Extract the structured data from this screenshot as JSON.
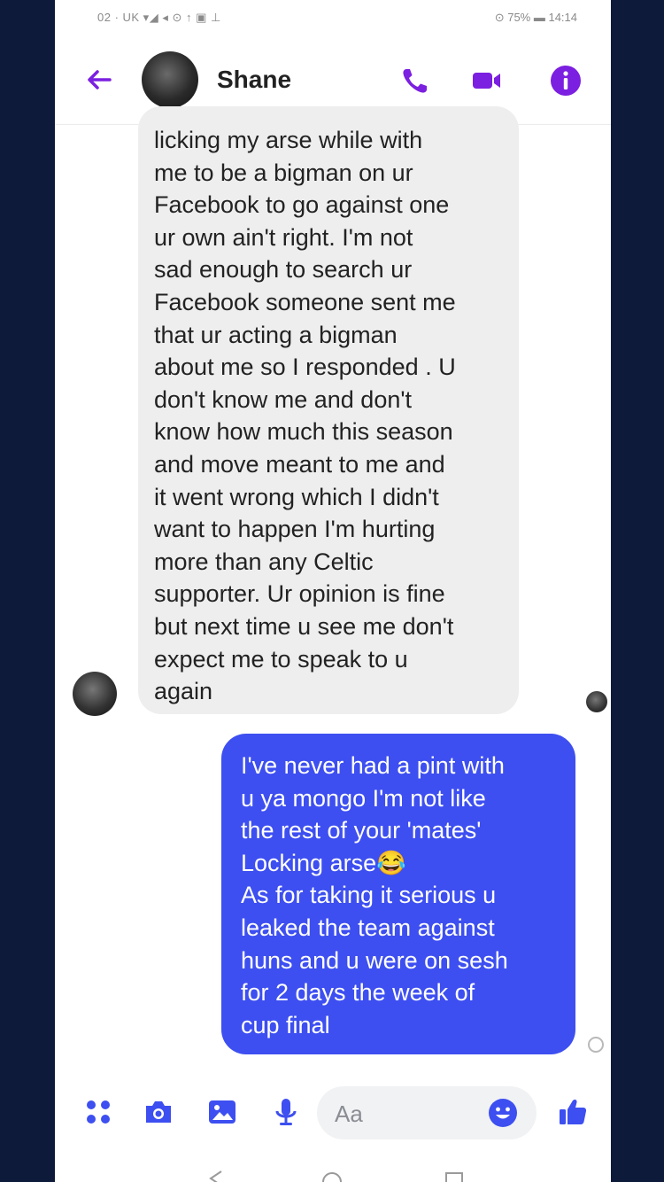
{
  "status_bar": {
    "left": "02 · UK ▾◢ ◂ ⊙ ↑ ▣ ⊥",
    "right": "⊙ 75% ▬ 14:14"
  },
  "header": {
    "contact_name": "Shane",
    "icons": [
      "back-arrow-icon",
      "phone-icon",
      "video-camera-icon",
      "info-icon"
    ],
    "accent_color": "#7b1fe0"
  },
  "messages": [
    {
      "direction": "received",
      "text": "licking my arse while with\nme to be a bigman on ur\nFacebook to go against one\nur own ain't right. I'm not\nsad enough to search ur\nFacebook someone sent me\nthat ur acting a bigman\nabout me so I responded . U\ndon't know me and don't\nknow how much this season\nand move meant to me and\nit went wrong which I didn't\nwant to happen I'm hurting\nmore than any Celtic\nsupporter. Ur opinion is fine\nbut next time u see me don't\nexpect me to speak to u\nagain",
      "bubble_color": "#eeeeee"
    },
    {
      "direction": "sent",
      "text": "I've never had a pint with\nu ya mongo I'm not like\nthe rest of your 'mates'\nLocking arse😂\nAs for taking it serious u\nleaked the team against\nhuns and u were on sesh\nfor 2 days the week of\ncup final",
      "bubble_color": "#3d4ff0"
    }
  ],
  "composer": {
    "placeholder": "Aa",
    "icons": [
      "apps-icon",
      "camera-icon",
      "gallery-icon",
      "microphone-icon",
      "emoji-icon",
      "thumbs-up-icon"
    ]
  }
}
